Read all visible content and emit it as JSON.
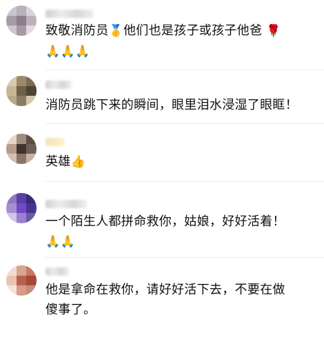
{
  "comments": [
    {
      "text": "致敬消防员",
      "badge_icon": "medal-icon",
      "text2": "他们也是孩子或孩子他爸",
      "end_icon": "rose-icon",
      "line2_icons": [
        "pray-icon",
        "pray-icon",
        "pray-icon"
      ],
      "avatar_colors": [
        "#c9c4cf",
        "#b7b0bd",
        "#d8d3dc",
        "#a89aa6",
        "#8d7e8c",
        "#bcb1ba",
        "#cdc6cc",
        "#a69aa3",
        "#e1dadf"
      ]
    },
    {
      "text": "消防员跳下来的瞬间，眼里泪水浸湿了眼眶！",
      "avatar_colors": [
        "#d9cbb0",
        "#9b8a6a",
        "#7b6c52",
        "#c7b690",
        "#6d5f4a",
        "#4e4536",
        "#b8a98a",
        "#8a7c63",
        "#d3c7ad"
      ]
    },
    {
      "text": "英雄",
      "end_icon": "thumbs-up-icon",
      "avatar_colors": [
        "#e6d6c4",
        "#9e8c7e",
        "#5c4d45",
        "#b69b8b",
        "#3e332f",
        "#6e5d54",
        "#d2c0b2",
        "#8a7568",
        "#c4b1a3"
      ]
    },
    {
      "text": "一个陌生人都拼命救你，姑娘，好好活着！",
      "line2_icons": [
        "pray-icon",
        "pray-icon"
      ],
      "avatar_colors": [
        "#8b7cc0",
        "#5a3fa6",
        "#3a2a7c",
        "#a58fd6",
        "#7248c4",
        "#4a3290",
        "#cfc4ea",
        "#9a80d3",
        "#6c58a8"
      ]
    },
    {
      "text": "他是拿命在救你，请好好活下去，不要在做",
      "text_line2": "傻事了。",
      "avatar_colors": [
        "#f0dcd2",
        "#d8a58f",
        "#c77b63",
        "#e9c3b1",
        "#b9614d",
        "#a7483a",
        "#f4e3db",
        "#d99a86",
        "#c58c7a"
      ]
    }
  ]
}
